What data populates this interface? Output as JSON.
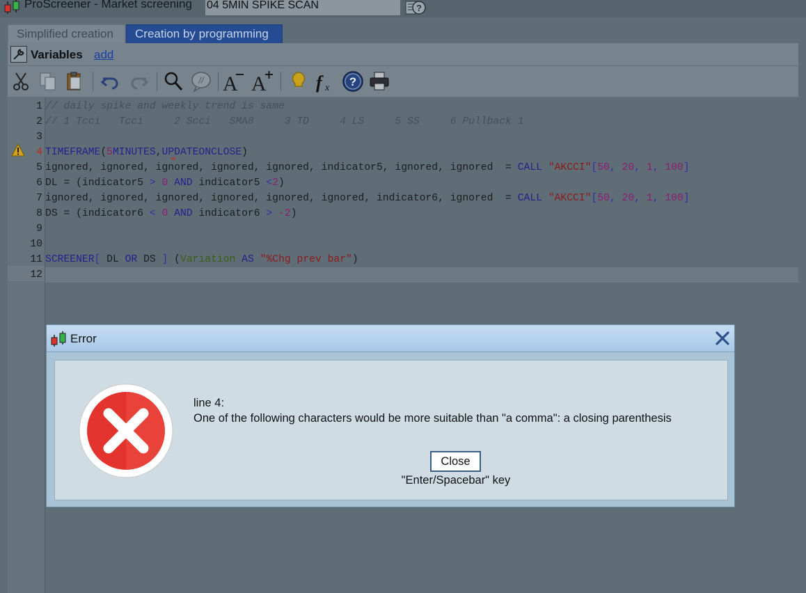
{
  "window": {
    "title": "ProScreener - Market screening",
    "screen_name": "04 5MIN SPIKE SCAN",
    "logo_icon": "candlestick-logo-icon",
    "help_icon": "help-document-icon"
  },
  "tabs": [
    {
      "label": "Simplified creation",
      "active": false
    },
    {
      "label": "Creation by programming",
      "active": true
    }
  ],
  "variables_bar": {
    "label": "Variables",
    "add_link": "add",
    "icon": "wrench-icon"
  },
  "toolbar": {
    "buttons": [
      "cut-icon",
      "copy-icon",
      "paste-icon",
      "undo-icon",
      "redo-icon",
      "search-icon",
      "comment-icon",
      "decrease-font-icon",
      "increase-font-icon",
      "lightbulb-icon",
      "function-icon",
      "help-icon",
      "print-icon"
    ]
  },
  "editor": {
    "line_numbers": [
      "1",
      "2",
      "3",
      "4",
      "5",
      "6",
      "7",
      "8",
      "9",
      "10",
      "11",
      "12"
    ],
    "error_line": "4",
    "active_line": "12",
    "lines": {
      "l1": "// daily spike and weekly trend is same",
      "l2": "// 1 Tcci   Tcci     2 Scci   SMA8     3 TD     4 LS     5 SS     6 Pullback 1",
      "l4": {
        "kw": "TIMEFRAME",
        "p1": "(",
        "num": "5",
        "arg1": "MINUTES",
        "comma": ",",
        "arg2": "UPDATEONCLOSE",
        "p2": ")"
      },
      "l5": {
        "text": "ignored, ignored, ignored, ignored, ignored, indicator5, ignored, ignored  = ",
        "kw": "CALL",
        "str": "\"AKCCI\"",
        "b1": "[",
        "n1": "50",
        "c1": ", ",
        "n2": "20",
        "c2": ", ",
        "n3": "1",
        "c3": ", ",
        "n4": "100",
        "b2": "]"
      },
      "l6": {
        "t1": "DL = (indicator5 ",
        "op1": ">",
        "sp1": " ",
        "n1": "0",
        "sp2": " ",
        "kw": "AND",
        "t2": " indicator5 ",
        "op2": "<",
        "n2": "2",
        "t3": ")"
      },
      "l7": {
        "text": "ignored, ignored, ignored, ignored, ignored, ignored, indicator6, ignored  = ",
        "kw": "CALL",
        "str": "\"AKCCI\"",
        "b1": "[",
        "n1": "50",
        "c1": ", ",
        "n2": "20",
        "c2": ", ",
        "n3": "1",
        "c3": ", ",
        "n4": "100",
        "b2": "]"
      },
      "l8": {
        "t1": "DS = (indicator6 ",
        "op1": "<",
        "sp1": " ",
        "n1": "0",
        "sp2": " ",
        "kw": "AND",
        "t2": " indicator6 ",
        "op2": ">",
        "sp3": " ",
        "n2": "-2",
        "t3": ")"
      },
      "l11": {
        "kw1": "SCREENER",
        "b1": "[",
        "t1": " DL ",
        "kw2": "OR",
        "t2": " DS ",
        "b2": "]",
        "sp": " ",
        "p1": "(",
        "fn": "Variation",
        "sp2": " ",
        "kw3": "AS",
        "sp3": " ",
        "str": "\"%Chg prev bar\"",
        "p2": ")"
      }
    }
  },
  "dialog": {
    "title": "Error",
    "message_line1": "line 4:",
    "message_line2": "One of the following characters would be more suitable than \"a comma\": a closing parenthesis",
    "close_button": "Close",
    "key_hint": "\"Enter/Spacebar\" key",
    "icon": "error-x-icon"
  },
  "colors": {
    "dialog_title_bg": "#a8c8e6",
    "active_tab": "#254b93",
    "error_red": "#e2332f",
    "keyword": "#24208c",
    "string": "#8b1a1a"
  }
}
